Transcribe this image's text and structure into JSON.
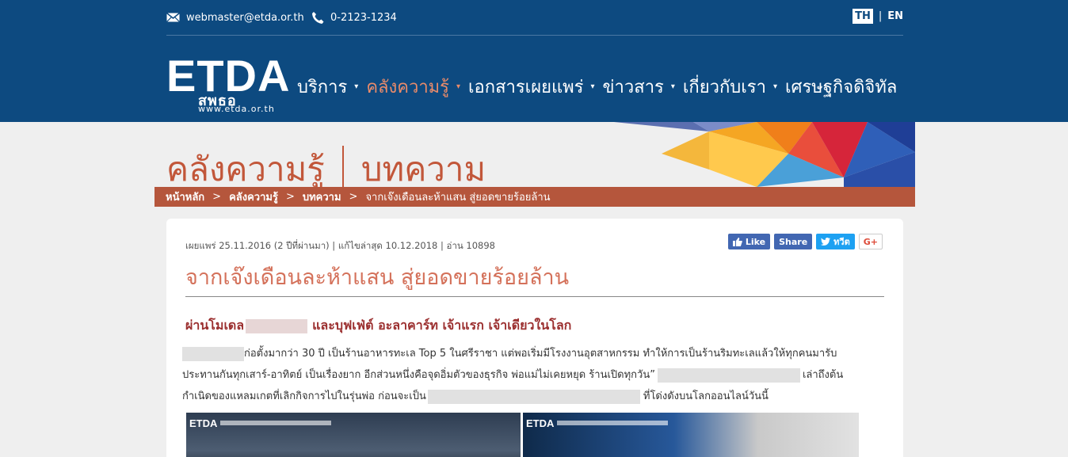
{
  "header": {
    "email": "webmaster@etda.or.th",
    "phone": "0-2123-1234",
    "lang_active": "TH",
    "lang_sep": "|",
    "lang_other": "EN",
    "logo": {
      "main": "ETDA",
      "thai": "สพธอ",
      "url": "www.etda.or.th"
    },
    "nav": [
      {
        "label": "บริการ",
        "caret": "▾",
        "active": false
      },
      {
        "label": "คลังความรู้",
        "caret": "▾",
        "active": true
      },
      {
        "label": "เอกสารเผยแพร่",
        "caret": "▾",
        "active": false
      },
      {
        "label": "ข่าวสาร",
        "caret": "▾",
        "active": false
      },
      {
        "label": "เกี่ยวกับเรา",
        "caret": "▾",
        "active": false
      },
      {
        "label": "เศรษฐกิจดิจิทัล",
        "caret": "",
        "active": false
      }
    ]
  },
  "banner": {
    "section": "คลังความรู้",
    "subsection": "บทความ",
    "breadcrumb": {
      "home": "หน้าหลัก",
      "level1": "คลังความรู้",
      "level2": "บทความ",
      "arrow": ">",
      "current": "จากเจ๊งเดือนละห้าแสน สู่ยอดขายร้อยล้าน"
    }
  },
  "article": {
    "meta": "เผยแพร่ 25.11.2016 (2 ปีที่ผ่านมา) | แก้ไขล่าสุด 10.12.2018 | อ่าน 10898",
    "social": {
      "like": "Like",
      "share": "Share",
      "tweet": "ทวีต",
      "gplus": "G+"
    },
    "title": "จากเจ๊งเดือนละห้าแสน สู่ยอดขายร้อยล้าน",
    "subtitle_a": "ผ่านโมเดล",
    "subtitle_b": "และบุฟเฟ่ต์ อะลาคาร์ท เจ้าแรก เจ้าเดียวในโลก",
    "line1": "ก่อตั้งมากว่า 30 ปี เป็นร้านอาหารทะเล Top 5 ในศรีราชา แต่พอเริ่มมีโรงงานอุตสาหกรรม ทำให้การเป็นร้านริมทะเลแล้วให้ทุกคนมารับ",
    "line2a": "ประทานกันทุกเสาร์-อาทิตย์ เป็นเรื่องยาก อีกส่วนหนึ่งคือจุดอิ่มตัวของธุรกิจ พ่อแม่ไม่เคยหยุด ร้านเปิดทุกวัน”",
    "line2b": "เล่าถึงต้น",
    "line3a": "กำเนิดของแหลมเกตที่เลิกกิจการไปในรุ่นพ่อ ก่อนจะเป็น",
    "line3b": "ที่โด่งดังบนโลกออนไลน์วันนี้",
    "photo_brand": "ETDA"
  }
}
